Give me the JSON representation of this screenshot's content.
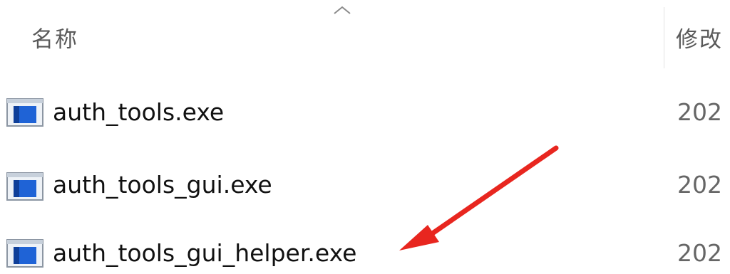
{
  "columns": {
    "name_label": "名称",
    "modified_label": "修改",
    "sort_icon": "chevron-up-icon"
  },
  "files": [
    {
      "name": "auth_tools.exe",
      "date": "202",
      "icon": "exe-file-icon"
    },
    {
      "name": "auth_tools_gui.exe",
      "date": "202",
      "icon": "exe-file-icon"
    },
    {
      "name": "auth_tools_gui_helper.exe",
      "date": "202",
      "icon": "exe-file-icon"
    }
  ],
  "annotation": {
    "icon": "red-arrow-icon",
    "color": "#e8261f",
    "points_to": "auth_tools_gui_helper.exe"
  }
}
